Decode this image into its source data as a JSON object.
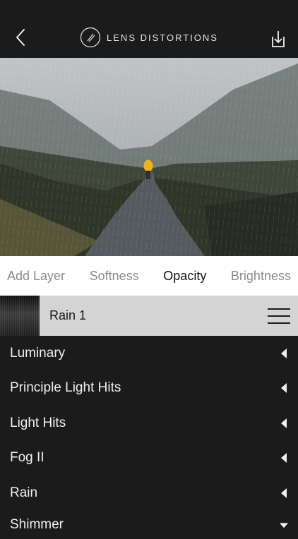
{
  "header": {
    "title": "LENS DISTORTIONS",
    "icons": {
      "back": "back-chevron-icon",
      "logo": "lens-logo-icon",
      "download": "download-tray-icon"
    }
  },
  "tabs": [
    {
      "label": "Add Layer",
      "active": false
    },
    {
      "label": "Softness",
      "active": false
    },
    {
      "label": "Opacity",
      "active": true
    },
    {
      "label": "Brightness",
      "active": false
    }
  ],
  "layer": {
    "name": "Rain 1"
  },
  "effects": [
    "Luminary",
    "Principle Light Hits",
    "Light Hits",
    "Fog II",
    "Rain",
    "Shimmer"
  ],
  "colors": {
    "background": "#1b1b1b",
    "tabs_bg": "#ffffff",
    "layer_bar_bg": "#d4d4d4",
    "active_tab_text": "#111111",
    "inactive_tab_text": "#8b8b8b"
  }
}
